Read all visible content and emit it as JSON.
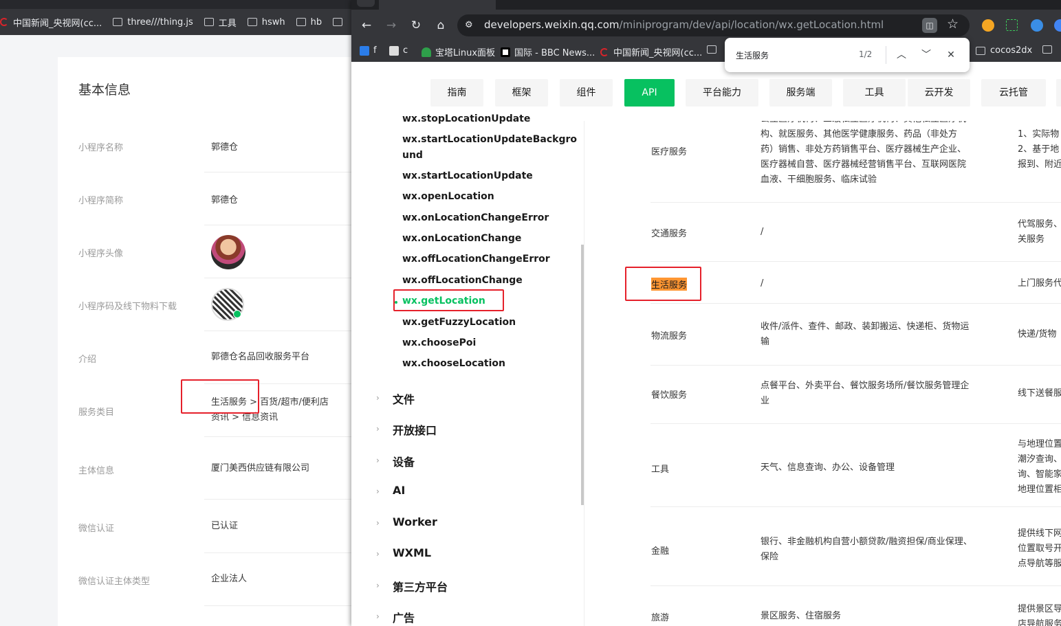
{
  "back_window": {
    "bookmarks": [
      "中国新闻_央视网(cc...",
      "three///thing.js",
      "工具",
      "hswh",
      "hb"
    ],
    "section_title": "基本信息",
    "rows": [
      {
        "label": "小程序名称",
        "value": "郭德仓"
      },
      {
        "label": "小程序简称",
        "value": "郭德仓"
      },
      {
        "label": "小程序头像",
        "value": ""
      },
      {
        "label": "小程序码及线下物料下载",
        "value": ""
      },
      {
        "label": "介绍",
        "value": "郭德仓名品回收服务平台"
      },
      {
        "label": "服务类目",
        "value": "生活服务 > 百货/超市/便利店",
        "value2": "资讯 > 信息资讯"
      },
      {
        "label": "主体信息",
        "value": "厦门美西供应链有限公司"
      },
      {
        "label": "微信认证",
        "value": "已认证"
      },
      {
        "label": "微信认证主体类型",
        "value": "企业法人"
      }
    ]
  },
  "front_window": {
    "url_host": "developers.weixin.qq.com",
    "url_path": "/miniprogram/dev/api/location/wx.getLocation.html",
    "bookmarks": [
      "f",
      "c",
      "宝塔Linux面板",
      "国际 - BBC News...",
      "中国新闻_央视网(cc...",
      "cocos2dx"
    ],
    "find": {
      "query": "生活服务",
      "count": "1/2"
    },
    "nav_tabs": [
      "指南",
      "框架",
      "组件",
      "API",
      "平台能力",
      "服务端",
      "工具",
      "云开发",
      "云托管"
    ],
    "nav_active": "API",
    "sidebar_items": [
      "wx.stopLocationUpdate",
      "wx.startLocationUpdateBackgro",
      "und",
      "wx.startLocationUpdate",
      "wx.openLocation",
      "wx.onLocationChangeError",
      "wx.onLocationChange",
      "wx.offLocationChangeError",
      "wx.offLocationChange",
      "wx.getLocation",
      "wx.getFuzzyLocation",
      "wx.choosePoi",
      "wx.chooseLocation"
    ],
    "sidebar_active": "wx.getLocation",
    "sidebar_categories": [
      "文件",
      "开放接口",
      "设备",
      "AI",
      "Worker",
      "WXML",
      "第三方平台",
      "广告"
    ],
    "table_rows": [
      {
        "category": "医疗服务",
        "desc": [
          "公立医疗机构、三级私立医疗机构、其他私立医疗机",
          "构、就医服务、其他医学健康服务、药品（非处方",
          "药）销售、非处方药销售平台、医疗器械生产企业、",
          "医疗器械自营、医疗器械经营销售平台、互联网医院",
          "血液、干细胞服务、临床试验"
        ],
        "extra": [
          "",
          "1、实际物",
          "2、基于地",
          "报到、附近"
        ]
      },
      {
        "category": "交通服务",
        "desc": [
          "/"
        ],
        "extra": [
          "代驾服务、",
          "关服务"
        ]
      },
      {
        "category": "生活服务",
        "desc": [
          "/"
        ],
        "extra": [
          "上门服务代"
        ]
      },
      {
        "category": "物流服务",
        "desc": [
          "收件/派件、查件、邮政、装卸搬运、快递柜、货物运",
          "输"
        ],
        "extra": [
          "快递/货物"
        ]
      },
      {
        "category": "餐饮服务",
        "desc": [
          "点餐平台、外卖平台、餐饮服务场所/餐饮服务管理企",
          "业"
        ],
        "extra": [
          "线下送餐服"
        ]
      },
      {
        "category": "工具",
        "desc": [
          "天气、信息查询、办公、设备管理"
        ],
        "extra": [
          "与地理位置",
          "潮汐查询、",
          "询、智能家",
          "地理位置相"
        ]
      },
      {
        "category": "金融",
        "desc": [
          "银行、非金融机构自营小额贷款/融资担保/商业保理、",
          "保险"
        ],
        "extra": [
          "提供线下网",
          "位置取号开",
          "点导航等服"
        ]
      },
      {
        "category": "旅游",
        "desc": [
          "景区服务、住宿服务"
        ],
        "extra": [
          "提供景区导",
          "店导航服务"
        ]
      }
    ]
  },
  "colors": {
    "accent_green": "#07c160",
    "annotation_red": "#e5202a",
    "find_highlight": "#ff9632",
    "chrome_dark": "#35363a"
  }
}
